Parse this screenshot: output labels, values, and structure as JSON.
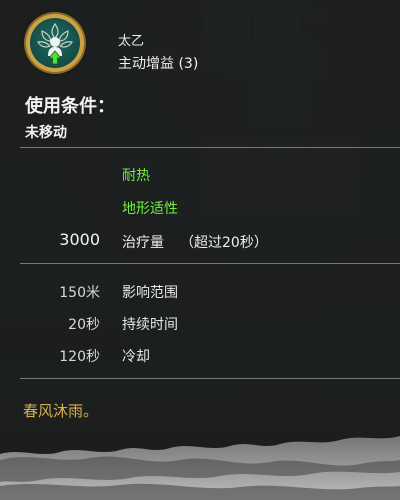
{
  "skill": {
    "hero_name": "太乙",
    "type_label": "主动增益 (3)",
    "icon": "taiyi-portrait-icon"
  },
  "conditions": {
    "title": "使用条件：",
    "value": "未移动"
  },
  "tags": [
    "耐热",
    "地形适性"
  ],
  "effect": {
    "value": "3000",
    "label": "治疗量",
    "note": "（超过20秒）"
  },
  "stats": [
    {
      "value": "150米",
      "label": "影响范围"
    },
    {
      "value": "20秒",
      "label": "持续时间"
    },
    {
      "value": "120秒",
      "label": "冷却"
    }
  ],
  "flavor_text": "春风沐雨。",
  "colors": {
    "tag_green": "#6ef03c",
    "flavor_gold": "#d9b24a",
    "icon_ring": "#c9a24a"
  }
}
